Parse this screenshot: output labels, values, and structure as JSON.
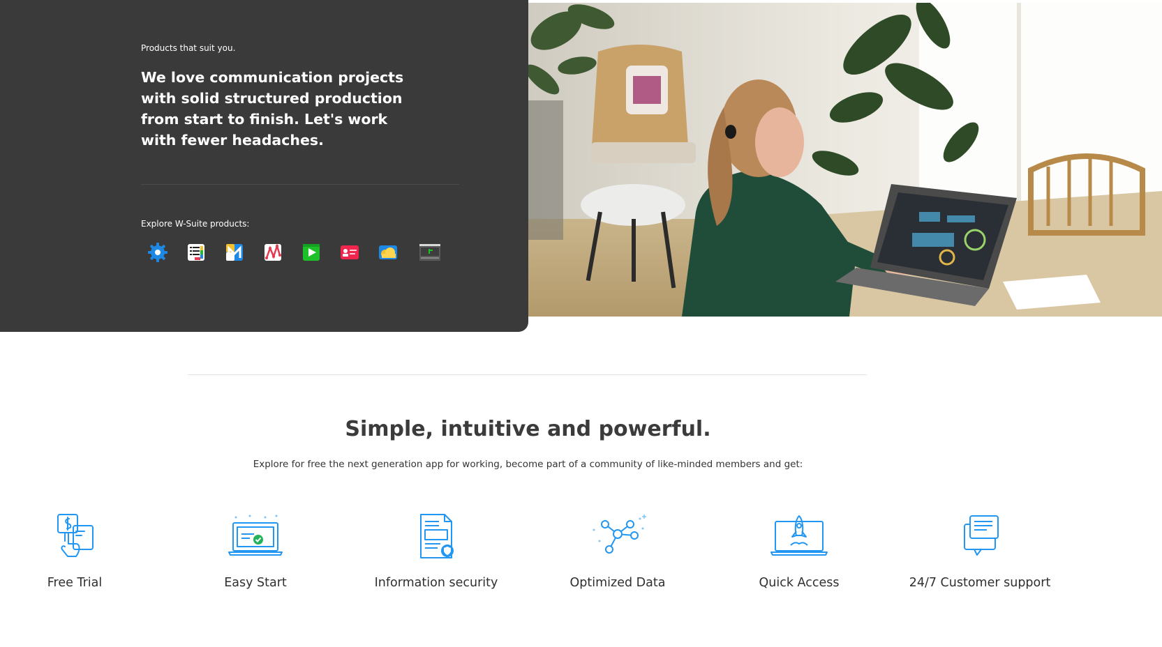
{
  "hero": {
    "eyebrow": "Products that suit you.",
    "headline": "We love communication projects with solid structured production from start to finish. Let's work with fewer headaches.",
    "explore_label": "Explore W-Suite products:",
    "products": [
      {
        "icon": "gear-app-icon",
        "color": "#1e88e5"
      },
      {
        "icon": "list-app-icon",
        "color": "#222222"
      },
      {
        "icon": "mail-app-icon",
        "color": "#1e88e5"
      },
      {
        "icon": "graph-app-icon",
        "color": "#e53950"
      },
      {
        "icon": "play-app-icon",
        "color": "#1ec02a"
      },
      {
        "icon": "contact-card-app-icon",
        "color": "#f0264e"
      },
      {
        "icon": "cloud-app-icon",
        "color": "#f2c12e"
      },
      {
        "icon": "chart-app-icon",
        "color": "#4a4a4a"
      }
    ]
  },
  "section": {
    "title": "Simple, intuitive and powerful.",
    "subtitle": "Explore for free the next generation app for working, become part of a community of like-minded members and get:"
  },
  "features": [
    {
      "label": "Free Trial",
      "icon": "hand-tap-dollar-icon"
    },
    {
      "label": "Easy Start",
      "icon": "laptop-check-icon"
    },
    {
      "label": "Information security",
      "icon": "document-shield-icon"
    },
    {
      "label": "Optimized Data",
      "icon": "network-nodes-icon"
    },
    {
      "label": "Quick Access",
      "icon": "laptop-rocket-icon"
    },
    {
      "label": "24/7 Customer support",
      "icon": "chat-bubbles-icon"
    }
  ],
  "colors": {
    "panel": "#3a3a3a",
    "accent": "#2196f3",
    "text_dark": "#333333"
  }
}
